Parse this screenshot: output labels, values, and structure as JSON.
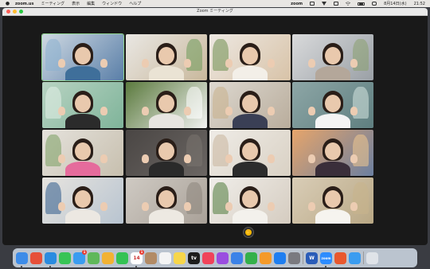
{
  "menubar": {
    "app_name": "zoom.us",
    "items": [
      "ミーティング",
      "表示",
      "編集",
      "ウィンドウ",
      "ヘルプ"
    ],
    "status_app": "zoom",
    "date": "8月14日(水)",
    "time": "21:52"
  },
  "window": {
    "title": "Zoom ミーティング"
  },
  "participants": [
    {
      "bg": "#cfd9e2",
      "accent": "#5a7fa8",
      "shirt": "#3f6f9a",
      "deco": "#8ab0d0",
      "active": true
    },
    {
      "bg": "#e9e7e3",
      "accent": "#c9b89c",
      "shirt": "#eae3d4",
      "deco": "#6d9b5a",
      "active": false
    },
    {
      "bg": "#ede8e2",
      "accent": "#d8c3a8",
      "shirt": "#f3efe8",
      "deco": "#6e8e4f",
      "active": false
    },
    {
      "bg": "#d9dadb",
      "accent": "#9aa0a6",
      "shirt": "#b4a79a",
      "deco": "#8aa070",
      "active": false
    },
    {
      "bg": "#b8d3c2",
      "accent": "#7fb49a",
      "shirt": "#2b2b2b",
      "deco": "#e4f1e8",
      "active": false
    },
    {
      "bg": "#5b7a3e",
      "accent": "#f2f2f2",
      "shirt": "#e7e5e0",
      "deco": "#ffffff",
      "active": false
    },
    {
      "bg": "#ddd8d0",
      "accent": "#b9ad9c",
      "shirt": "#3a3f55",
      "deco": "#c9b08a",
      "active": false
    },
    {
      "bg": "#8da6a6",
      "accent": "#5f7f80",
      "shirt": "#f4f4f4",
      "deco": "#d6e6e0",
      "active": false
    },
    {
      "bg": "#e5e2dc",
      "accent": "#c7bfae",
      "shirt": "#e56b9c",
      "deco": "#7a9f60",
      "active": false
    },
    {
      "bg": "#4a4644",
      "accent": "#6b6663",
      "shirt": "#2a2a2a",
      "deco": "#7a7470",
      "active": false
    },
    {
      "bg": "#efece7",
      "accent": "#d9d1c4",
      "shirt": "#2c2c2c",
      "deco": "#c9b59c",
      "active": false
    },
    {
      "bg": "#e6a56b",
      "accent": "#6b7fa0",
      "shirt": "#3a2e3a",
      "deco": "#f1c890",
      "active": false
    },
    {
      "bg": "#e7e4df",
      "accent": "#b8c4d0",
      "shirt": "#ece8e2",
      "deco": "#2e5a8a",
      "active": false
    },
    {
      "bg": "#cfcac3",
      "accent": "#a9a198",
      "shirt": "#ede9e2",
      "deco": "#8c857c",
      "active": false
    },
    {
      "bg": "#f0eeea",
      "accent": "#d5ccc0",
      "shirt": "#f3f1ec",
      "deco": "#4e7a3a",
      "active": false
    },
    {
      "bg": "#d9cdb7",
      "accent": "#b9a885",
      "shirt": "#f6f4ef",
      "deco": "#c8b48c",
      "active": false
    }
  ],
  "dock": {
    "apps": [
      {
        "name": "finder-icon",
        "label": "",
        "color": "#3d8ce8"
      },
      {
        "name": "launchpad-icon",
        "label": "",
        "color": "#e6503a"
      },
      {
        "name": "safari-icon",
        "label": "",
        "color": "#2a8be0"
      },
      {
        "name": "messages-icon",
        "label": "",
        "color": "#37c456"
      },
      {
        "name": "mail-icon",
        "label": "",
        "color": "#3a9cf0",
        "badge": "1"
      },
      {
        "name": "maps-icon",
        "label": "",
        "color": "#5fb85a"
      },
      {
        "name": "photos-icon",
        "label": "",
        "color": "#f2b233"
      },
      {
        "name": "facetime-icon",
        "label": "",
        "color": "#34c254"
      },
      {
        "name": "calendar-icon",
        "label": "14",
        "color": "#ffffff",
        "badge": "1"
      },
      {
        "name": "contacts-icon",
        "label": "",
        "color": "#b28b66"
      },
      {
        "name": "reminders-icon",
        "label": "",
        "color": "#f4f4f4"
      },
      {
        "name": "notes-icon",
        "label": "",
        "color": "#f7d64a"
      },
      {
        "name": "tv-icon",
        "label": "tv",
        "color": "#1c1c1c"
      },
      {
        "name": "music-icon",
        "label": "",
        "color": "#f0435a"
      },
      {
        "name": "podcasts-icon",
        "label": "",
        "color": "#9a4de0"
      },
      {
        "name": "keynote-icon",
        "label": "",
        "color": "#3b82e8"
      },
      {
        "name": "numbers-icon",
        "label": "",
        "color": "#34b04a"
      },
      {
        "name": "pages-icon",
        "label": "",
        "color": "#f49a2a"
      },
      {
        "name": "app-store-icon",
        "label": "",
        "color": "#1e7ef0"
      },
      {
        "name": "system-settings-icon",
        "label": "",
        "color": "#7a7a80"
      },
      {
        "name": "word-icon",
        "label": "W",
        "color": "#2a5cb8"
      },
      {
        "name": "zoom-app-icon",
        "label": "zoom",
        "color": "#2d8cff"
      },
      {
        "name": "tool-icon",
        "label": "",
        "color": "#e8582e"
      },
      {
        "name": "app-icon",
        "label": "",
        "color": "#3a9cf0"
      },
      {
        "name": "trash-icon",
        "label": "",
        "color": "#dfe3e8"
      }
    ]
  }
}
